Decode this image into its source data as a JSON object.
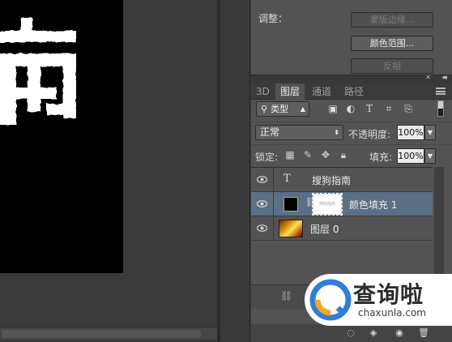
{
  "canvas": {
    "glyph_char": "南"
  },
  "adjust_panel": {
    "label": "调整：",
    "buttons": [
      "蒙版边缘...",
      "颜色范围...",
      "反相"
    ]
  },
  "layers_panel": {
    "tabs": [
      "3D",
      "图层",
      "通道",
      "路径"
    ],
    "active_tab": "图层",
    "filter": {
      "kind": "类型",
      "icons": [
        "image-filter-icon",
        "adjustment-filter-icon",
        "type-filter-icon",
        "shape-filter-icon",
        "smart-object-filter-icon"
      ]
    },
    "blend_mode": "正常",
    "opacity_label": "不透明度:",
    "opacity_value": "100%",
    "lock_label": "锁定:",
    "fill_label": "填充:",
    "fill_value": "100%",
    "layers": [
      {
        "name": "搜狗指南",
        "kind": "text"
      },
      {
        "name": "颜色填充 1",
        "kind": "fill",
        "selected": true,
        "mask_text": "搜狗指南"
      },
      {
        "name": "图层 0",
        "kind": "image"
      }
    ]
  },
  "watermark": {
    "title": "查询啦",
    "domain": "chaxunla.com"
  },
  "colors": {
    "selected_layer": "#5b6f86",
    "panel_bg": "#535353",
    "watermark_orange": "#f5a623",
    "watermark_blue": "#2f7fd6"
  }
}
